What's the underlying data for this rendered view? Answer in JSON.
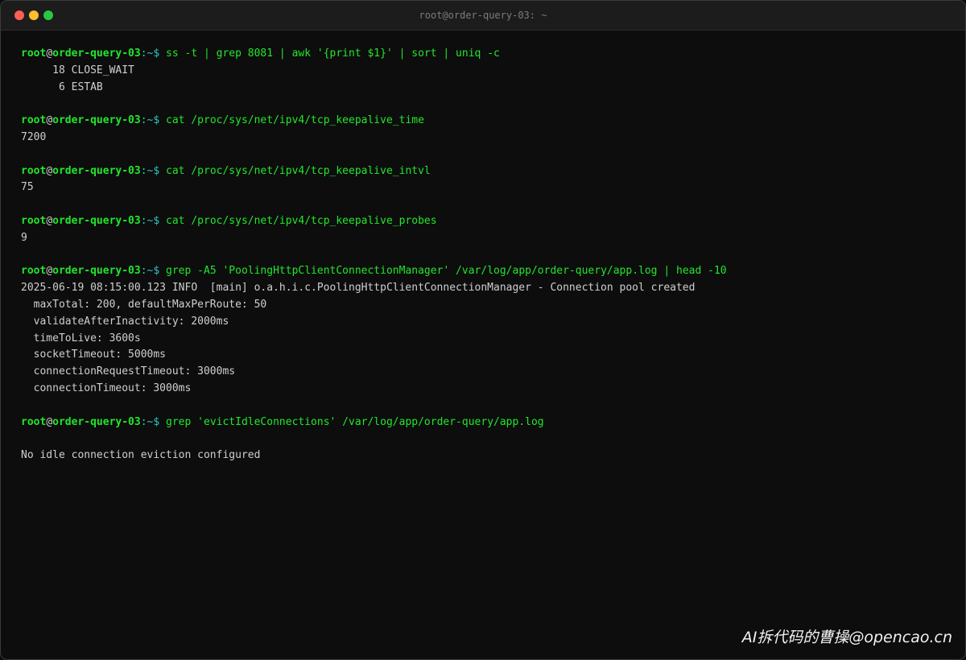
{
  "window": {
    "title": "root@order-query-03: ~"
  },
  "prompt": {
    "user": "root",
    "at": "@",
    "host": "order-query-03",
    "path": ":~$"
  },
  "blocks": [
    {
      "command": "ss -t | grep 8081 | awk '{print $1}' | sort | uniq -c",
      "output": [
        "     18 CLOSE_WAIT",
        "      6 ESTAB"
      ]
    },
    {
      "command": "cat /proc/sys/net/ipv4/tcp_keepalive_time",
      "output": [
        "7200"
      ]
    },
    {
      "command": "cat /proc/sys/net/ipv4/tcp_keepalive_intvl",
      "output": [
        "75"
      ]
    },
    {
      "command": "cat /proc/sys/net/ipv4/tcp_keepalive_probes",
      "output": [
        "9"
      ]
    },
    {
      "command": "grep -A5 'PoolingHttpClientConnectionManager' /var/log/app/order-query/app.log | head -10",
      "output": [
        "2025-06-19 08:15:00.123 INFO  [main] o.a.h.i.c.PoolingHttpClientConnectionManager - Connection pool created",
        "  maxTotal: 200, defaultMaxPerRoute: 50",
        "  validateAfterInactivity: 2000ms",
        "  timeToLive: 3600s",
        "  socketTimeout: 5000ms",
        "  connectionRequestTimeout: 3000ms",
        "  connectionTimeout: 3000ms"
      ]
    },
    {
      "command": "grep 'evictIdleConnections' /var/log/app/order-query/app.log",
      "output": [
        "",
        "No idle connection eviction configured"
      ]
    }
  ],
  "watermark": "AI拆代码的曹操@opencao.cn"
}
